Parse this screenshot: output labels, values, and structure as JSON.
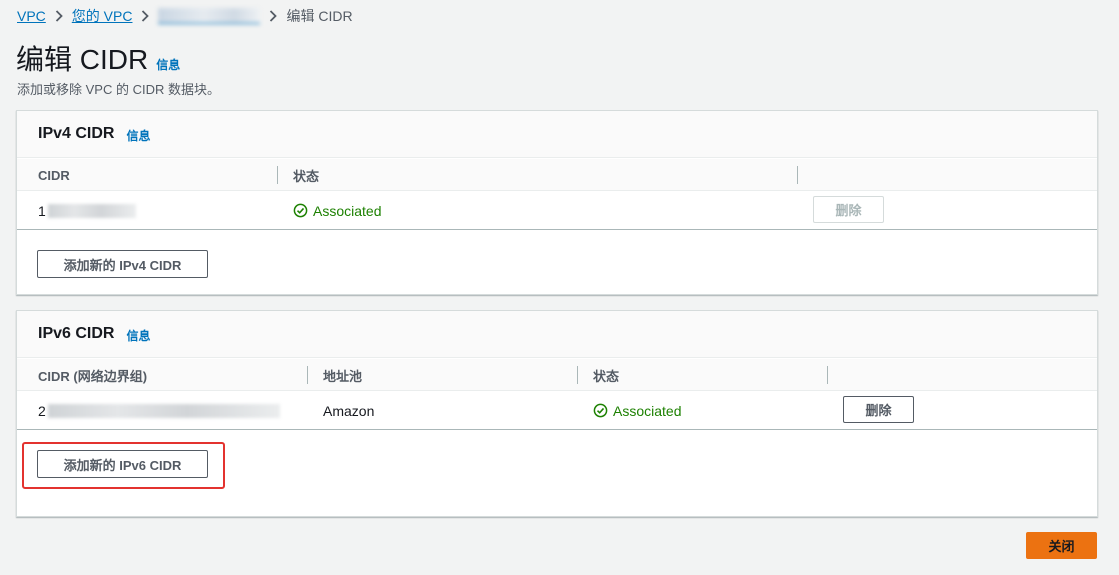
{
  "breadcrumb": {
    "items": [
      "VPC",
      "您的 VPC",
      "vpc-…",
      "编辑 CIDR"
    ]
  },
  "page": {
    "title": "编辑 CIDR",
    "info": "信息",
    "description": "添加或移除 VPC 的 CIDR 数据块。"
  },
  "ipv4": {
    "title": "IPv4 CIDR",
    "info": "信息",
    "columns": [
      "CIDR",
      "状态"
    ],
    "rows": [
      {
        "cidr_prefix": "1",
        "status": "Associated",
        "delete_label": "删除",
        "delete_disabled": true
      }
    ],
    "add_button": "添加新的 IPv4 CIDR"
  },
  "ipv6": {
    "title": "IPv6 CIDR",
    "info": "信息",
    "columns": [
      "CIDR (网络边界组)",
      "地址池",
      "状态"
    ],
    "rows": [
      {
        "cidr_prefix": "2",
        "pool": "Amazon",
        "status": "Associated",
        "delete_label": "删除",
        "delete_disabled": false
      }
    ],
    "add_button": "添加新的 IPv6 CIDR"
  },
  "footer": {
    "close_button": "关闭"
  },
  "colors": {
    "link": "#0073bb",
    "success": "#1d8102",
    "primary": "#ec7211",
    "highlight": "#e3332f"
  }
}
